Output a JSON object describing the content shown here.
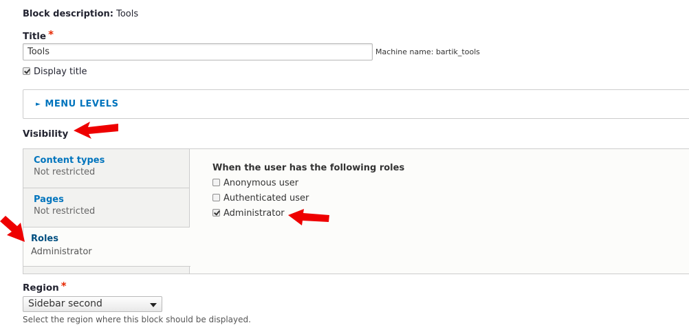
{
  "block_description": {
    "label": "Block description:",
    "value": "Tools"
  },
  "title_field": {
    "label": "Title",
    "required_mark": "*",
    "value": "Tools",
    "machine_name": "Machine name: bartik_tools"
  },
  "display_title": {
    "label": "Display title",
    "checked": true
  },
  "menu_levels": {
    "label": "MENU LEVELS",
    "expander_icon": "triangle-right-icon"
  },
  "visibility": {
    "label": "Visibility",
    "tabs": [
      {
        "title": "Content types",
        "summary": "Not restricted"
      },
      {
        "title": "Pages",
        "summary": "Not restricted"
      },
      {
        "title": "Roles",
        "summary": "Administrator"
      }
    ],
    "pane": {
      "heading": "When the user has the following roles",
      "roles": [
        {
          "label": "Anonymous user",
          "checked": false
        },
        {
          "label": "Authenticated user",
          "checked": false
        },
        {
          "label": "Administrator",
          "checked": true
        }
      ]
    }
  },
  "region": {
    "label": "Region",
    "required_mark": "*",
    "selected": "Sidebar second",
    "description": "Select the region where this block should be displayed."
  },
  "colors": {
    "link": "#0074bd",
    "required": "#e62600",
    "annotation_arrow": "#ee0000"
  }
}
